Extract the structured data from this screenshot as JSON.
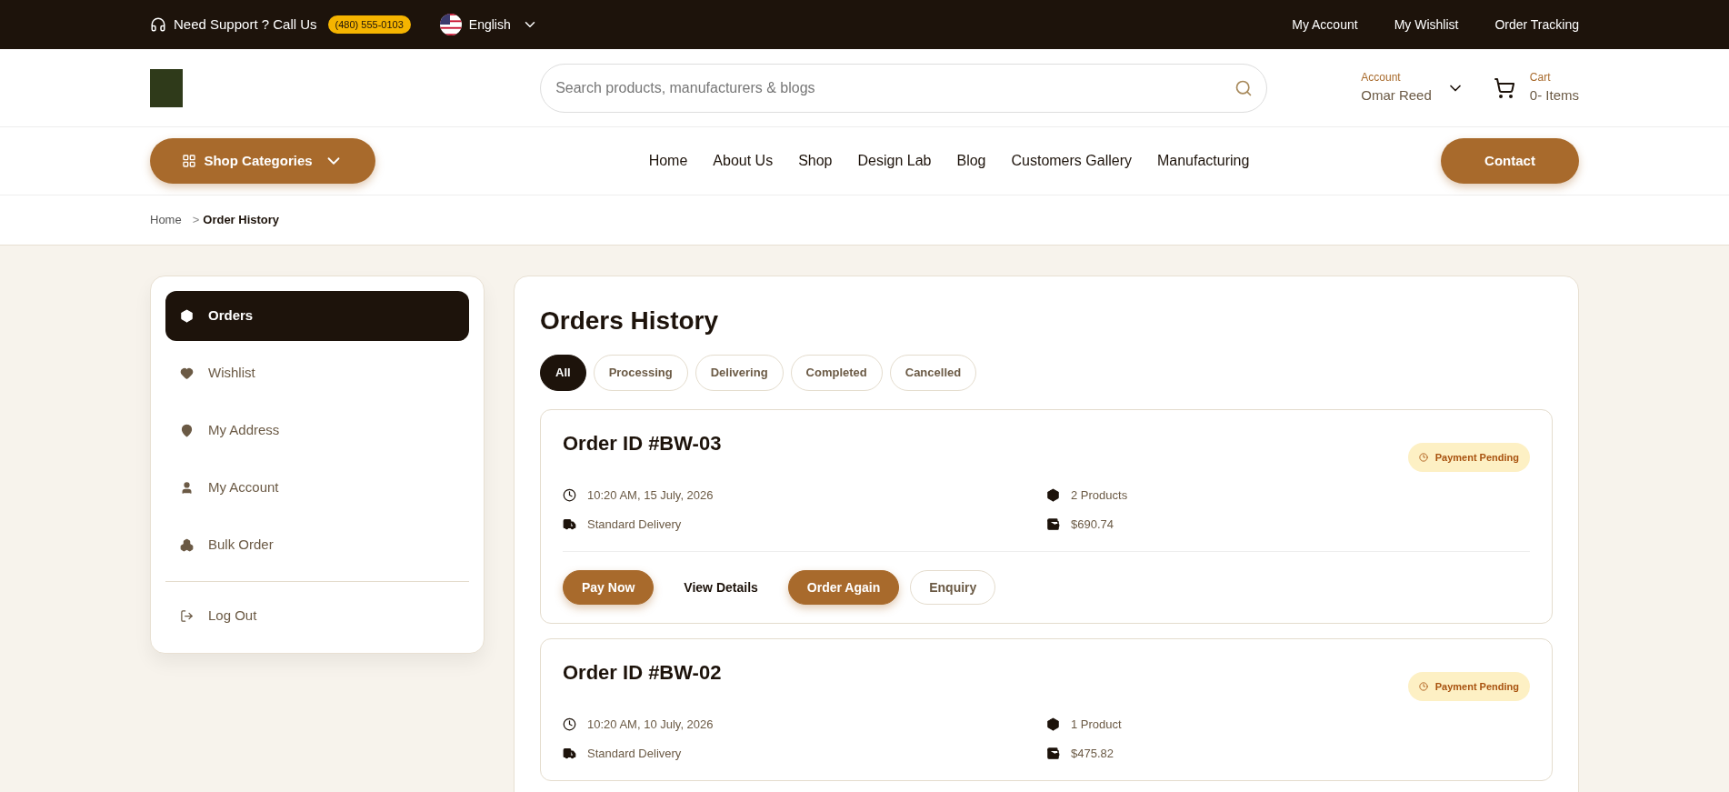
{
  "topbar": {
    "support": "Need Support ? Call Us",
    "phone": "(480) 555-0103",
    "language": "English",
    "links": [
      "My Account",
      "My Wishlist",
      "Order Tracking"
    ]
  },
  "header": {
    "search": {
      "placeholder": "Search products, manufacturers & blogs"
    },
    "account": {
      "label": "Account",
      "name": "Omar Reed"
    },
    "cart": {
      "label": "Cart",
      "count": "0- Items"
    }
  },
  "nav": {
    "categories": "Shop Categories",
    "items": [
      "Home",
      "About Us",
      "Shop",
      "Design Lab",
      "Blog",
      "Customers Gallery",
      "Manufacturing"
    ],
    "contact": "Contact"
  },
  "breadcrumb": {
    "separator": ">",
    "items": [
      {
        "label": "Home",
        "current": false
      },
      {
        "label": "Order History",
        "current": true
      }
    ]
  },
  "sidebar": {
    "items": [
      {
        "label": "Orders",
        "selected": true
      },
      {
        "label": "Wishlist",
        "selected": false
      },
      {
        "label": "My Address",
        "selected": false
      },
      {
        "label": "My Account",
        "selected": false
      },
      {
        "label": "Bulk Order",
        "selected": false
      }
    ],
    "logout": "Log Out"
  },
  "main": {
    "title": "Orders History",
    "filters": [
      {
        "label": "All",
        "selected": true
      },
      {
        "label": "Processing",
        "selected": false
      },
      {
        "label": "Delivering",
        "selected": false
      },
      {
        "label": "Completed",
        "selected": false
      },
      {
        "label": "Cancelled",
        "selected": false
      }
    ],
    "orders": [
      {
        "id": "Order ID #BW-03",
        "status": "Payment Pending",
        "date": "10:20 AM, 15 July, 2026",
        "products": "2 Products",
        "delivery": "Standard Delivery",
        "total": "$690.74",
        "actions": [
          {
            "label": "Pay Now",
            "kind": "primary"
          },
          {
            "label": "View Details",
            "kind": "text"
          },
          {
            "label": "Order Again",
            "kind": "primary"
          },
          {
            "label": "Enquiry",
            "kind": "outline"
          }
        ]
      },
      {
        "id": "Order ID #BW-02",
        "status": "Payment Pending",
        "date": "10:20 AM, 10 July, 2026",
        "products": "1 Product",
        "delivery": "Standard Delivery",
        "total": "$475.82"
      }
    ]
  }
}
